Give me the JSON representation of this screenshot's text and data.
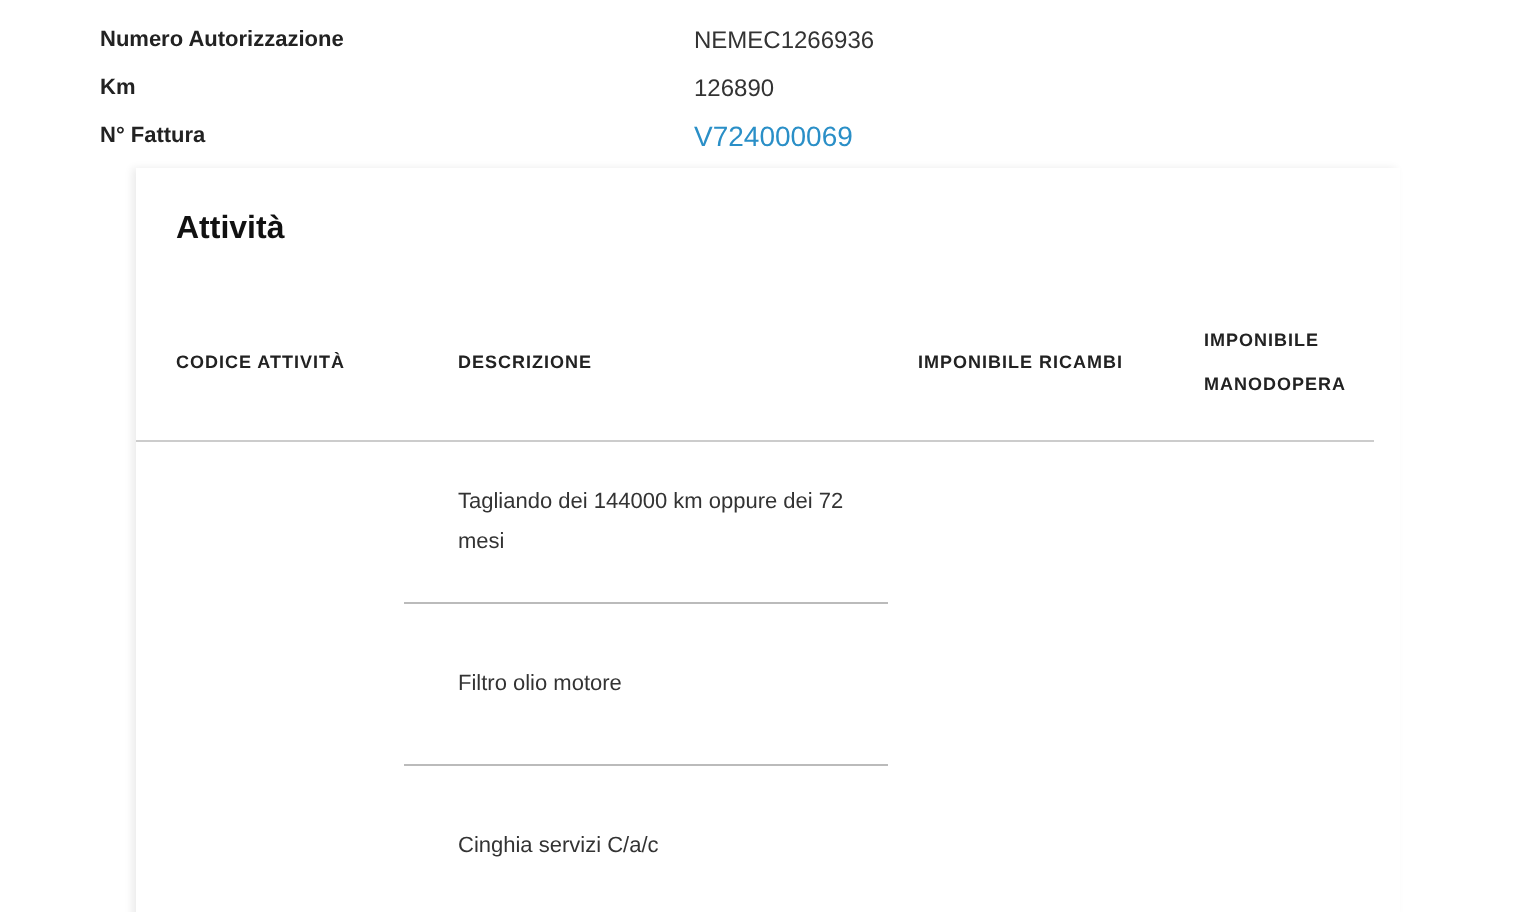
{
  "details": [
    {
      "label": "Numero Autorizzazione",
      "value": "NEMEC1266936",
      "kind": "text"
    },
    {
      "label": "Km",
      "value": "126890",
      "kind": "text"
    },
    {
      "label": "N° Fattura",
      "value": "V724000069",
      "kind": "link"
    }
  ],
  "activities": {
    "title": "Attività",
    "columns": [
      "CODICE ATTIVITÀ",
      "DESCRIZIONE",
      "IMPONIBILE RICAMBI",
      "IMPONIBILE MANODOPERA"
    ],
    "rows": [
      {
        "description": "Tagliando dei 144000 km oppure dei 72 mesi"
      },
      {
        "description": "Filtro olio motore"
      },
      {
        "description": "Cinghia servizi C/a/c"
      }
    ]
  }
}
